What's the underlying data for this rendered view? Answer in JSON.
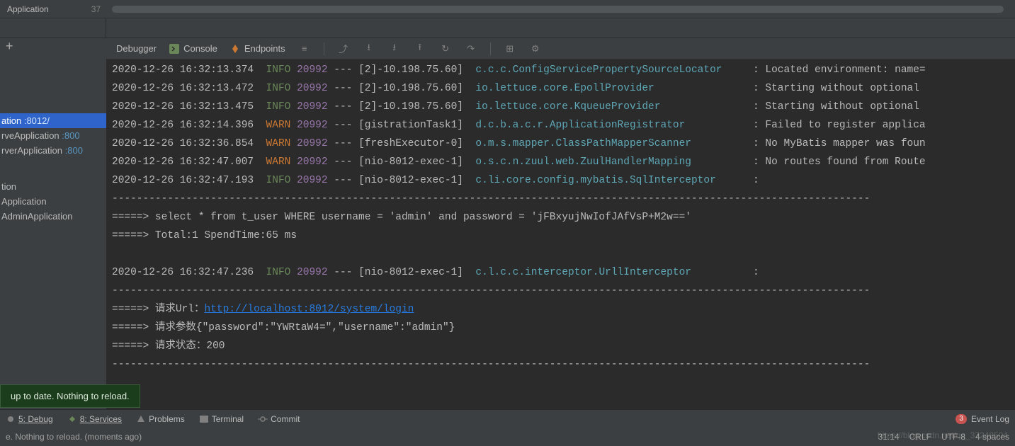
{
  "topbar": {
    "tab": "Application",
    "line": "37"
  },
  "sidebar": {
    "items": [
      {
        "name": "ation",
        "port": ":8012/",
        "selected": true
      },
      {
        "name": "rveApplication",
        "port": ":800"
      },
      {
        "name": "rverApplication",
        "port": ":800"
      }
    ],
    "lower": [
      {
        "name": "tion"
      },
      {
        "name": "Application"
      },
      {
        "name": "AdminApplication"
      }
    ]
  },
  "toolbar": {
    "debugger": "Debugger",
    "console": "Console",
    "endpoints": "Endpoints"
  },
  "log": [
    {
      "ts": "2020-12-26 16:32:13.374",
      "lvl": "INFO",
      "pid": "20992",
      "thr": "[2]-10.198.75.60]",
      "cls": "c.c.c.ConfigServicePropertySourceLocator",
      "msg": "Located environment: name="
    },
    {
      "ts": "2020-12-26 16:32:13.472",
      "lvl": "INFO",
      "pid": "20992",
      "thr": "[2]-10.198.75.60]",
      "cls": "io.lettuce.core.EpollProvider",
      "msg": "Starting without optional "
    },
    {
      "ts": "2020-12-26 16:32:13.475",
      "lvl": "INFO",
      "pid": "20992",
      "thr": "[2]-10.198.75.60]",
      "cls": "io.lettuce.core.KqueueProvider",
      "msg": "Starting without optional "
    },
    {
      "ts": "2020-12-26 16:32:14.396",
      "lvl": "WARN",
      "pid": "20992",
      "thr": "[gistrationTask1]",
      "cls": "d.c.b.a.c.r.ApplicationRegistrator",
      "msg": "Failed to register applica"
    },
    {
      "ts": "2020-12-26 16:32:36.854",
      "lvl": "WARN",
      "pid": "20992",
      "thr": "[freshExecutor-0]",
      "cls": "o.m.s.mapper.ClassPathMapperScanner",
      "msg": "No MyBatis mapper was foun"
    },
    {
      "ts": "2020-12-26 16:32:47.007",
      "lvl": "WARN",
      "pid": "20992",
      "thr": "[nio-8012-exec-1]",
      "cls": "o.s.c.n.zuul.web.ZuulHandlerMapping",
      "msg": "No routes found from Route"
    },
    {
      "ts": "2020-12-26 16:32:47.193",
      "lvl": "INFO",
      "pid": "20992",
      "thr": "[nio-8012-exec-1]",
      "cls": "c.li.core.config.mybatis.SqlInterceptor",
      "msg": ""
    }
  ],
  "sql": {
    "sep": "---------------------------------------------------------------------------------------------------------------------------",
    "query": "=====> select * from t_user WHERE username = 'admin' and password = 'jFBxyujNwIofJAfVsP+M2w=='",
    "total": "=====> Total:1 SpendTime:65 ms"
  },
  "log2": {
    "ts": "2020-12-26 16:32:47.236",
    "lvl": "INFO",
    "pid": "20992",
    "thr": "[nio-8012-exec-1]",
    "cls": "c.l.c.c.interceptor.UrllInterceptor",
    "msg": ""
  },
  "req": {
    "url_label": "=====> 请求Url：",
    "url": "http://localhost:8012/system/login",
    "params": "=====> 请求参数{\"password\":\"YWRtaW4=\",\"username\":\"admin\"}",
    "status": "=====> 请求状态：200"
  },
  "toast": "up to date. Nothing to reload.",
  "bottom": {
    "debug": "5: Debug",
    "services": "8: Services",
    "problems": "Problems",
    "terminal": "Terminal",
    "commit": "Commit",
    "eventlog": "Event Log",
    "badge": "3"
  },
  "status": {
    "msg": "e. Nothing to reload. (moments ago)",
    "pos": "31:14",
    "enc": "CRLF",
    "cs": "UTF-8",
    "indent": "4 spaces"
  },
  "watermark": "https://blog.csdn.net/qq_37248504"
}
